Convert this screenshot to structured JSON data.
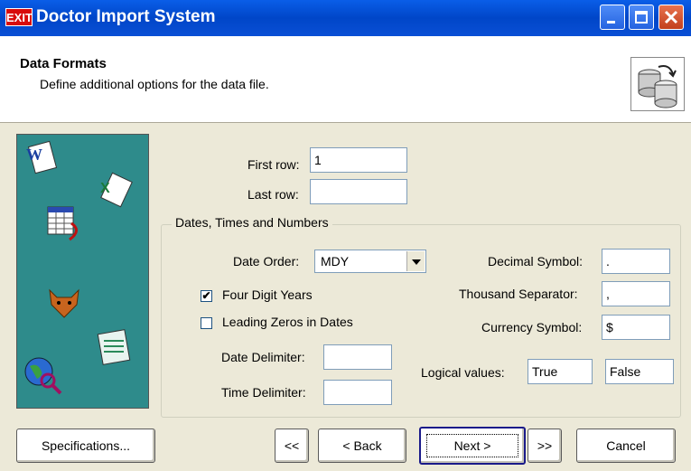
{
  "window": {
    "app_icon_text": "EXIT",
    "title": "Doctor Import System"
  },
  "header": {
    "title": "Data Formats",
    "subtitle": "Define additional options for the data file."
  },
  "form": {
    "first_row_label": "First row:",
    "first_row_value": "1",
    "last_row_label": "Last row:",
    "last_row_value": "",
    "group_title": "Dates, Times and Numbers",
    "date_order_label": "Date Order:",
    "date_order_value": "MDY",
    "four_digit_years_label": "Four Digit Years",
    "four_digit_years_checked": true,
    "leading_zeros_label": "Leading Zeros in Dates",
    "leading_zeros_checked": false,
    "date_delimiter_label": "Date Delimiter:",
    "date_delimiter_value": "",
    "time_delimiter_label": "Time Delimiter:",
    "time_delimiter_value": "",
    "decimal_symbol_label": "Decimal Symbol:",
    "decimal_symbol_value": ".",
    "thousand_separator_label": "Thousand Separator:",
    "thousand_separator_value": ",",
    "currency_symbol_label": "Currency Symbol:",
    "currency_symbol_value": "$",
    "logical_values_label": "Logical values:",
    "logical_true_value": "True",
    "logical_false_value": "False"
  },
  "buttons": {
    "specifications": "Specifications...",
    "first": "<<",
    "back": "< Back",
    "next": "Next >",
    "last": ">>",
    "cancel": "Cancel"
  },
  "sidebar_icons": [
    "word-document-icon",
    "excel-document-icon",
    "table-icon",
    "foxpro-icon",
    "notepad-icon",
    "globe-search-icon"
  ],
  "colors": {
    "titlebar": "#0046c8",
    "sidebar": "#2e8b8b",
    "dialog": "#ece9d8"
  }
}
